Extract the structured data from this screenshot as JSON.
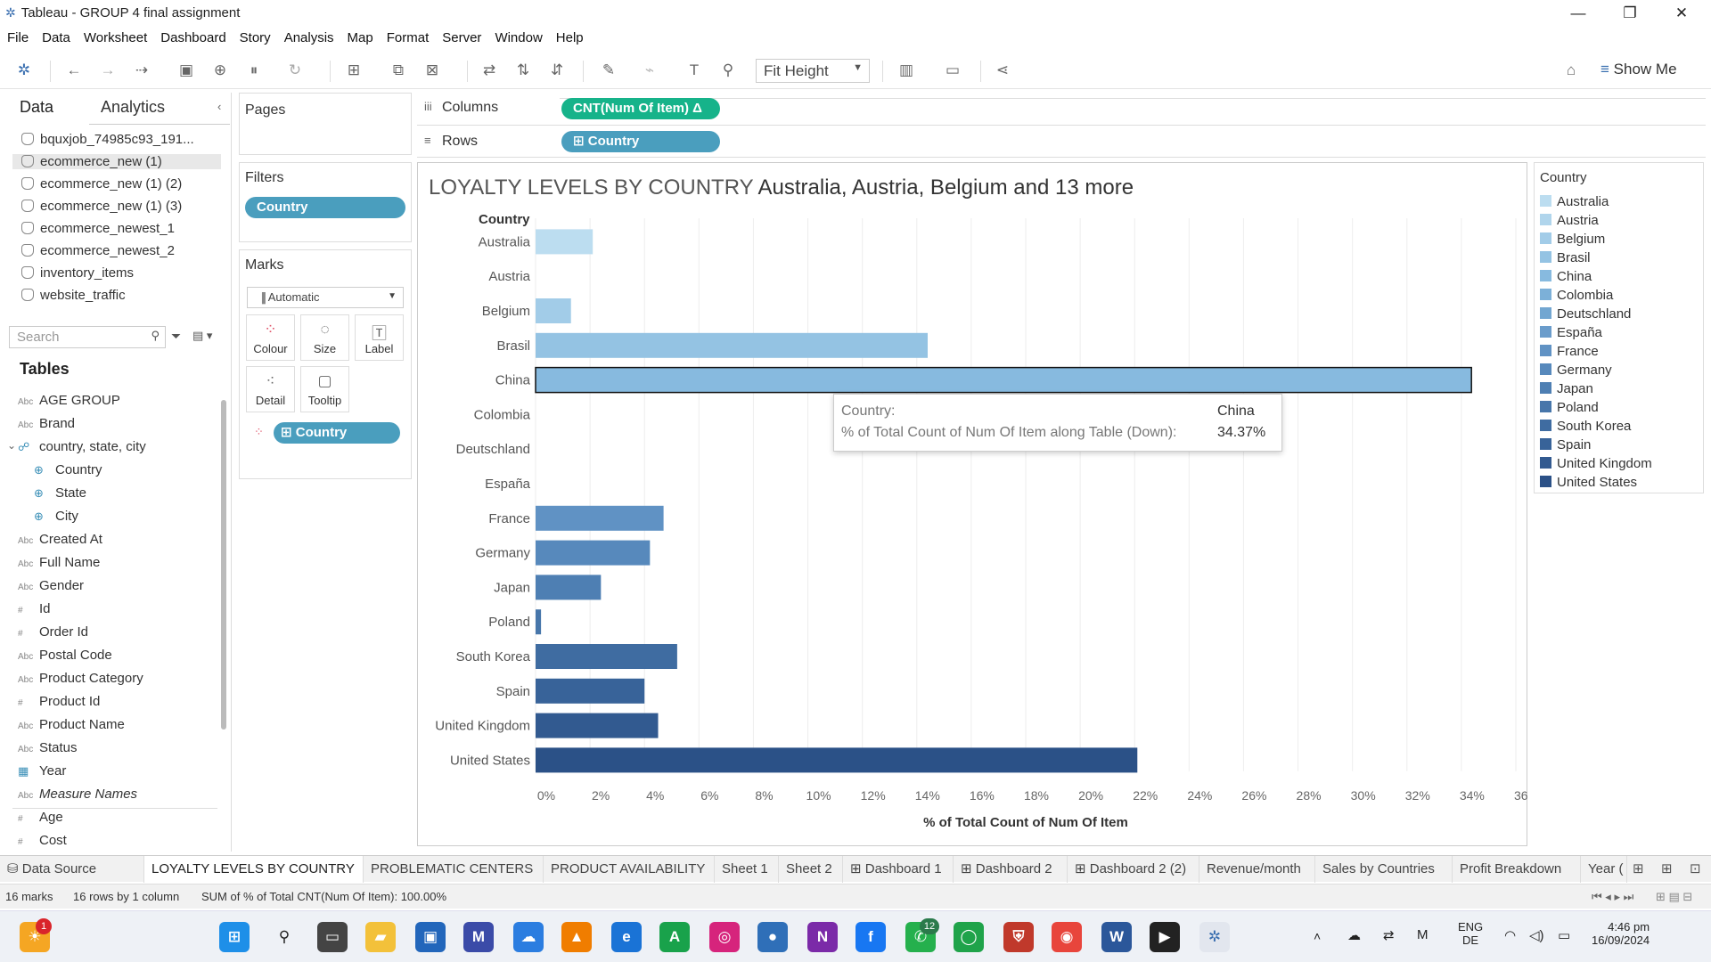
{
  "window": {
    "title": "Tableau - GROUP 4 final assignment",
    "minimize": "—",
    "restore": "❐",
    "close": "✕"
  },
  "menu": [
    "File",
    "Data",
    "Worksheet",
    "Dashboard",
    "Story",
    "Analysis",
    "Map",
    "Format",
    "Server",
    "Window",
    "Help"
  ],
  "toolbar": {
    "fit": "Fit Height",
    "show_me": "Show Me"
  },
  "data_pane": {
    "tab_data": "Data",
    "tab_analytics": "Analytics",
    "sources": [
      "bquxjob_74985c93_191...",
      "ecommerce_new (1)",
      "ecommerce_new (1) (2)",
      "ecommerce_new (1) (3)",
      "ecommerce_newest_1",
      "ecommerce_newest_2",
      "inventory_items",
      "website_traffic"
    ],
    "search_placeholder": "Search",
    "tables_heading": "Tables",
    "fields": [
      {
        "type": "Abc",
        "name": "AGE GROUP"
      },
      {
        "type": "Abc",
        "name": "Brand"
      },
      {
        "type": "geo",
        "name": "country, state, city"
      },
      {
        "type": "globe",
        "name": "Country"
      },
      {
        "type": "globe",
        "name": "State"
      },
      {
        "type": "globe",
        "name": "City"
      },
      {
        "type": "Abc",
        "name": "Created At"
      },
      {
        "type": "Abc",
        "name": "Full Name"
      },
      {
        "type": "Abc",
        "name": "Gender"
      },
      {
        "type": "#",
        "name": "Id"
      },
      {
        "type": "#",
        "name": "Order Id"
      },
      {
        "type": "Abc",
        "name": "Postal Code"
      },
      {
        "type": "Abc",
        "name": "Product Category"
      },
      {
        "type": "#",
        "name": "Product Id"
      },
      {
        "type": "Abc",
        "name": "Product Name"
      },
      {
        "type": "Abc",
        "name": "Status"
      },
      {
        "type": "cal",
        "name": "Year"
      },
      {
        "type": "Abc",
        "name": "Measure Names"
      },
      {
        "type": "#",
        "name": "Age"
      },
      {
        "type": "#",
        "name": "Cost"
      }
    ]
  },
  "cards": {
    "pages": "Pages",
    "filters": "Filters",
    "filter_pill": "Country",
    "marks": "Marks",
    "marks_type": "Automatic",
    "mark_buttons": [
      "Colour",
      "Size",
      "Label",
      "Detail",
      "Tooltip"
    ],
    "marks_pill": "Country"
  },
  "shelves": {
    "columns": "Columns",
    "rows": "Rows",
    "columns_pill": "CNT(Num Of Item)",
    "rows_pill": "Country",
    "delta": "Δ"
  },
  "viz": {
    "title_main": "LOYALTY LEVELS BY COUNTRY ",
    "title_sub": "Australia, Austria, Belgium and 13 more"
  },
  "chart_data": {
    "type": "bar",
    "orientation": "horizontal",
    "ylabel": "Country",
    "xlabel": "% of Total Count of Num Of Item",
    "categories": [
      "Australia",
      "Austria",
      "Belgium",
      "Brasil",
      "China",
      "Colombia",
      "Deutschland",
      "España",
      "France",
      "Germany",
      "Japan",
      "Poland",
      "South Korea",
      "Spain",
      "United Kingdom",
      "United States"
    ],
    "values": [
      2.1,
      0,
      1.3,
      14.4,
      34.37,
      0,
      0,
      0,
      4.7,
      4.2,
      2.4,
      0.2,
      5.2,
      4.0,
      4.5,
      22.1
    ],
    "xlim": [
      0,
      36
    ],
    "xticks": [
      "0%",
      "2%",
      "4%",
      "6%",
      "8%",
      "10%",
      "12%",
      "14%",
      "16%",
      "18%",
      "20%",
      "22%",
      "24%",
      "26%",
      "28%",
      "30%",
      "32%",
      "34%",
      "36%"
    ],
    "colors": [
      "#bcddf0",
      "#b0d5ec",
      "#a2cce8",
      "#94c3e3",
      "#87badf",
      "#7cb0d8",
      "#72a6d1",
      "#6a9ccb",
      "#6092c4",
      "#5789bc",
      "#4e7fb3",
      "#4776aa",
      "#3f6ca1",
      "#386399",
      "#325a90",
      "#2b5187"
    ],
    "highlighted": "China"
  },
  "tooltip": {
    "k1": "Country:",
    "v1": "China",
    "k2": "% of Total Count of Num Of Item along Table (Down):",
    "v2": "34.37%"
  },
  "legend": {
    "title": "Country"
  },
  "sheets": [
    "Data Source",
    "LOYALTY LEVELS BY COUNTRY",
    "PROBLEMATIC CENTERS",
    "PRODUCT AVAILABILITY",
    "Sheet 1",
    "Sheet 2",
    "Dashboard 1",
    "Dashboard 2",
    "Dashboard 2 (2)",
    "Revenue/month",
    "Sales by Countries",
    "Profit Breakdown",
    "Year ("
  ],
  "status": {
    "marks": "16 marks",
    "rows": "16 rows by 1 column",
    "sum": "SUM of % of Total CNT(Num Of Item): 100.00%"
  },
  "taskbar": {
    "badge1": "1",
    "badge2": "12",
    "lang1": "ENG",
    "lang2": "DE",
    "time": "4:46 pm",
    "date": "16/09/2024"
  }
}
